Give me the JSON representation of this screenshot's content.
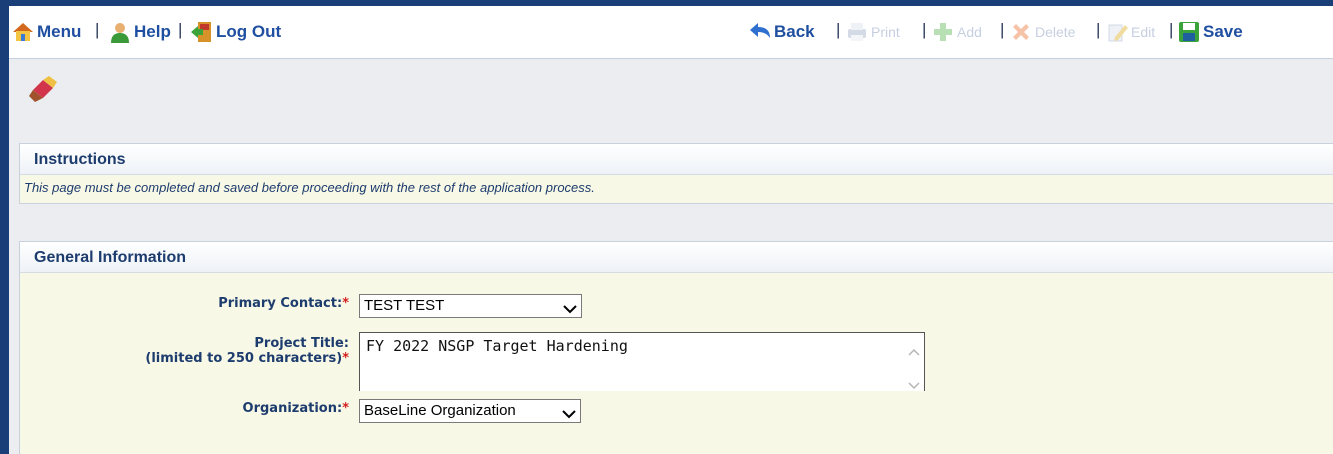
{
  "toolbar": {
    "menu": "Menu",
    "help": "Help",
    "logout": "Log Out",
    "back": "Back",
    "print": "Print",
    "add": "Add",
    "delete": "Delete",
    "edit": "Edit",
    "save": "Save",
    "separator": "|"
  },
  "instructions": {
    "title": "Instructions",
    "text": "This page must be completed and saved before proceeding with the rest of the application process."
  },
  "general": {
    "title": "General Information",
    "primary_contact_label": "Primary Contact:",
    "primary_contact_value": "TEST TEST",
    "project_title_label": "Project Title:",
    "project_title_sublabel": "(limited to 250 characters)",
    "project_title_value": "FY 2022 NSGP Target Hardening",
    "organization_label": "Organization:",
    "organization_value": "BaseLine Organization",
    "required_mark": "*"
  },
  "colors": {
    "accent": "#1f4fa0",
    "heading": "#1d3c6e",
    "required": "#d41f1f",
    "panel_bg": "#f8f8e6"
  }
}
